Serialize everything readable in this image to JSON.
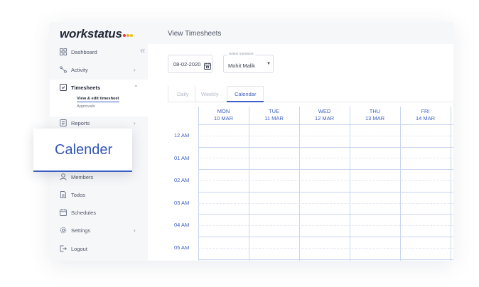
{
  "brand": {
    "name": "workstatus",
    "dot_colors": [
      "#e53935",
      "#f5a623",
      "#f2c200"
    ]
  },
  "sidebar": {
    "collapse_icon": "double-chevron-left-icon",
    "items": [
      {
        "label": "Dashboard",
        "icon": "dashboard-grid-icon",
        "chevron": false
      },
      {
        "label": "Activity",
        "icon": "activity-icon",
        "chevron": true
      },
      {
        "label": "Timesheets",
        "icon": "timesheet-icon",
        "chevron": true,
        "active": true
      },
      {
        "label": "Reports",
        "icon": "report-icon",
        "chevron": true
      },
      {
        "label": "Members",
        "icon": "user-icon",
        "chevron": false
      },
      {
        "label": "Todos",
        "icon": "document-icon",
        "chevron": false
      },
      {
        "label": "Schedules",
        "icon": "calendar-icon",
        "chevron": false
      },
      {
        "label": "Settings",
        "icon": "gear-icon",
        "chevron": true
      },
      {
        "label": "Logout",
        "icon": "logout-icon",
        "chevron": false
      }
    ],
    "chevron_right": "›",
    "chevron_down": "⌄",
    "timesheet_sub": {
      "current": "View & edit timesheet",
      "other": "Approvals"
    }
  },
  "main": {
    "title": "View Timesheets",
    "date_value": "08-02-2020",
    "member_legend": "Select members",
    "member_value": "Mohit Malik",
    "tabs": [
      "Daily",
      "Weekly",
      "Calendar"
    ],
    "active_tab": "Calendar",
    "days": [
      {
        "name": "MON",
        "date": "10 MAR"
      },
      {
        "name": "TUE",
        "date": "11 MAR"
      },
      {
        "name": "WED",
        "date": "12 MAR"
      },
      {
        "name": "THU",
        "date": "13 MAR"
      },
      {
        "name": "FRI",
        "date": "14 MAR"
      }
    ],
    "hours": [
      "12 AM",
      "01 AM",
      "02 AM",
      "03 AM",
      "04 AM",
      "05 AM"
    ]
  },
  "callout": {
    "text": "Calender"
  },
  "colors": {
    "accent": "#3d5fc4",
    "grid_line": "#c9d5ef"
  }
}
